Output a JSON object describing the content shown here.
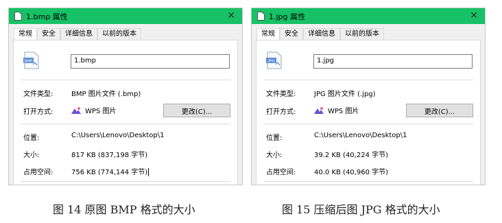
{
  "colors": {
    "titlebar": "#17c266",
    "wps_icon": "#6c4fd6"
  },
  "dialogs": [
    {
      "title": "1.bmp 属性",
      "tabs": [
        "常规",
        "安全",
        "详细信息",
        "以前的版本"
      ],
      "active_tab": "常规",
      "icon": "bmp-file-icon",
      "icon_text": "BMP",
      "filename": "1.bmp",
      "file_type_label": "文件类型:",
      "file_type_value": "BMP 图片文件 (.bmp)",
      "opens_with_label": "打开方式:",
      "opens_with_app": "WPS 图片",
      "change_button": "更改(C)...",
      "location_label": "位置:",
      "location_value": "C:\\Users\\Lenovo\\Desktop\\1",
      "size_label": "大小:",
      "size_value": "817 KB (837,198 字节)",
      "disk_label": "占用空间:",
      "disk_value": "756 KB (774,144 字节)"
    },
    {
      "title": "1.jpg 属性",
      "tabs": [
        "常规",
        "安全",
        "详细信息",
        "以前的版本"
      ],
      "active_tab": "常规",
      "icon": "jpg-file-icon",
      "icon_text": "JPG",
      "filename": "1.jpg",
      "file_type_label": "文件类型:",
      "file_type_value": "JPG 图片文件 (.jpg)",
      "opens_with_label": "打开方式:",
      "opens_with_app": "WPS 图片",
      "change_button": "更改(C)...",
      "location_label": "位置:",
      "location_value": "C:\\Users\\Lenovo\\Desktop\\1",
      "size_label": "大小:",
      "size_value": "39.2 KB (40,224 字节)",
      "disk_label": "占用空间:",
      "disk_value": "40.0 KB (40,960 字节)"
    }
  ],
  "captions": {
    "left": "图 14 原图 BMP 格式的大小",
    "right": "图 15 压缩后图 JPG 格式的大小"
  }
}
